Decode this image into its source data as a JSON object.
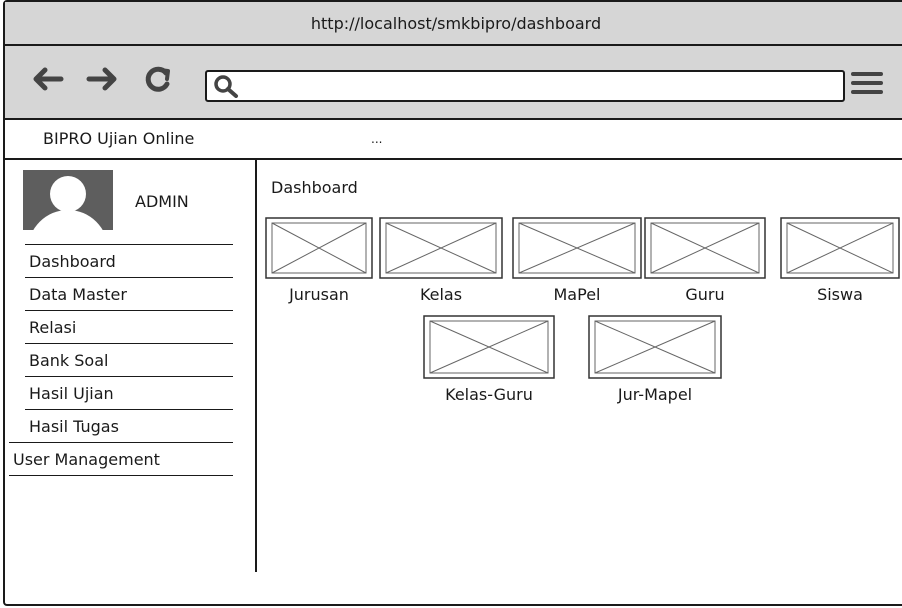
{
  "browser": {
    "title": "http://localhost/smkbipro/dashboard",
    "address_value": "",
    "back_icon": "arrow-left-icon",
    "forward_icon": "arrow-right-icon",
    "reload_icon": "reload-icon",
    "search_icon": "search-icon",
    "menu_icon": "hamburger-menu-icon"
  },
  "app": {
    "brand": "BIPRO Ujian Online",
    "nav_more": "..."
  },
  "sidebar": {
    "user_label": "ADMIN",
    "items": [
      {
        "label": "Dashboard"
      },
      {
        "label": "Data Master"
      },
      {
        "label": "Relasi"
      },
      {
        "label": "Bank Soal"
      },
      {
        "label": "Hasil Ujian"
      },
      {
        "label": "Hasil Tugas"
      },
      {
        "label": "User Management"
      }
    ]
  },
  "main": {
    "title": "Dashboard",
    "tiles": [
      {
        "label": "Jurusan"
      },
      {
        "label": "Kelas"
      },
      {
        "label": "MaPel"
      },
      {
        "label": "Guru"
      },
      {
        "label": "Siswa"
      },
      {
        "label": "Kelas-Guru"
      },
      {
        "label": "Jur-Mapel"
      }
    ]
  }
}
